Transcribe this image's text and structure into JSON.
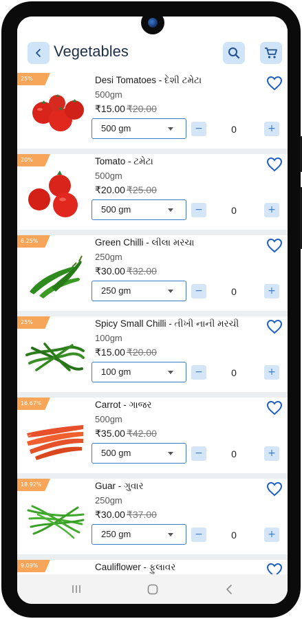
{
  "header": {
    "title": "Vegetables",
    "back_icon": "chevron-left-icon",
    "search_icon": "search-icon",
    "cart_icon": "cart-icon",
    "accent": "#cfe4f8"
  },
  "products": [
    {
      "badge": "25%",
      "name": "Desi Tomatoes - દેશી ટમેટા",
      "weight": "500gm",
      "price": "₹15.00",
      "mrp": "₹20.00",
      "unit": "500 gm",
      "qty": "0",
      "image": "tomatoes"
    },
    {
      "badge": "20%",
      "name": "Tomato - ટમેટા",
      "weight": "500gm",
      "price": "₹20.00",
      "mrp": "₹25.00",
      "unit": "500 gm",
      "qty": "0",
      "image": "tomato"
    },
    {
      "badge": "6.25%",
      "name": "Green Chilli - લીલા મરચા",
      "weight": "250gm",
      "price": "₹30.00",
      "mrp": "₹32.00",
      "unit": "250 gm",
      "qty": "0",
      "image": "green-chilli"
    },
    {
      "badge": "25%",
      "name": "Spicy Small Chilli - તીખી નાની મરચી",
      "weight": "100gm",
      "price": "₹15.00",
      "mrp": "₹20.00",
      "unit": "100 gm",
      "qty": "0",
      "image": "small-chilli"
    },
    {
      "badge": "16.67%",
      "name": "Carrot - ગાજર",
      "weight": "500gm",
      "price": "₹35.00",
      "mrp": "₹42.00",
      "unit": "500 gm",
      "qty": "0",
      "image": "carrot"
    },
    {
      "badge": "18.92%",
      "name": "Guar - ગુવાર",
      "weight": "250gm",
      "price": "₹30.00",
      "mrp": "₹37.00",
      "unit": "250 gm",
      "qty": "0",
      "image": "guar"
    },
    {
      "badge": "9.09%",
      "name": "Cauliflower - ફુલાવર",
      "weight": "",
      "price": "",
      "mrp": "",
      "unit": "",
      "qty": "",
      "image": "cauliflower"
    }
  ],
  "controls": {
    "minus": "−",
    "plus": "+"
  },
  "navbar": {
    "recents_icon": "recents-icon",
    "home_icon": "home-icon",
    "back_icon": "back-nav-icon"
  }
}
